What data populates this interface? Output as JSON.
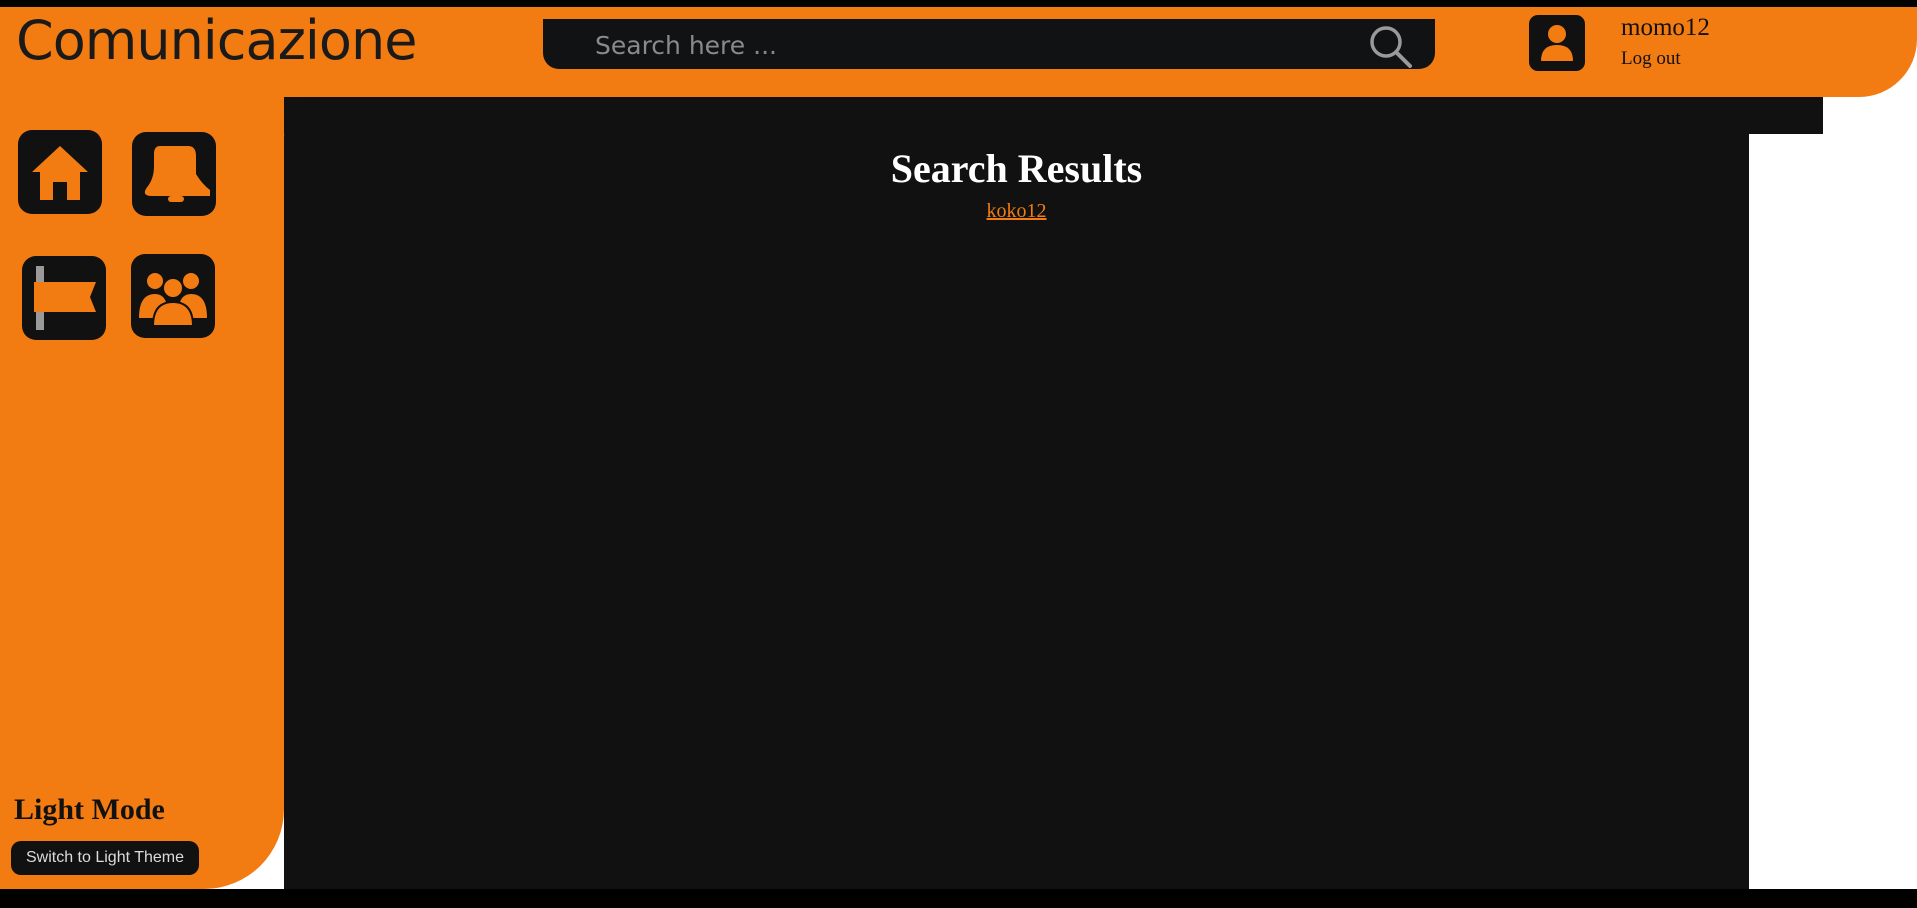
{
  "header": {
    "brand": "Comunicazione",
    "search_placeholder": "Search here ...",
    "search_icon": "search-icon",
    "user": {
      "avatar_icon": "user-icon",
      "username": "momo12",
      "logout_label": "Log out"
    }
  },
  "sidebar": {
    "nav": [
      {
        "icon": "home-icon"
      },
      {
        "icon": "bell-icon"
      },
      {
        "icon": "flag-icon"
      },
      {
        "icon": "group-icon"
      }
    ],
    "mode_title": "Light Mode",
    "theme_button_label": "Switch to Light Theme"
  },
  "main": {
    "title": "Search Results",
    "results": [
      "koko12"
    ]
  },
  "colors": {
    "accent": "#f27c12",
    "dark": "#111111",
    "text_light": "#ffffff"
  }
}
